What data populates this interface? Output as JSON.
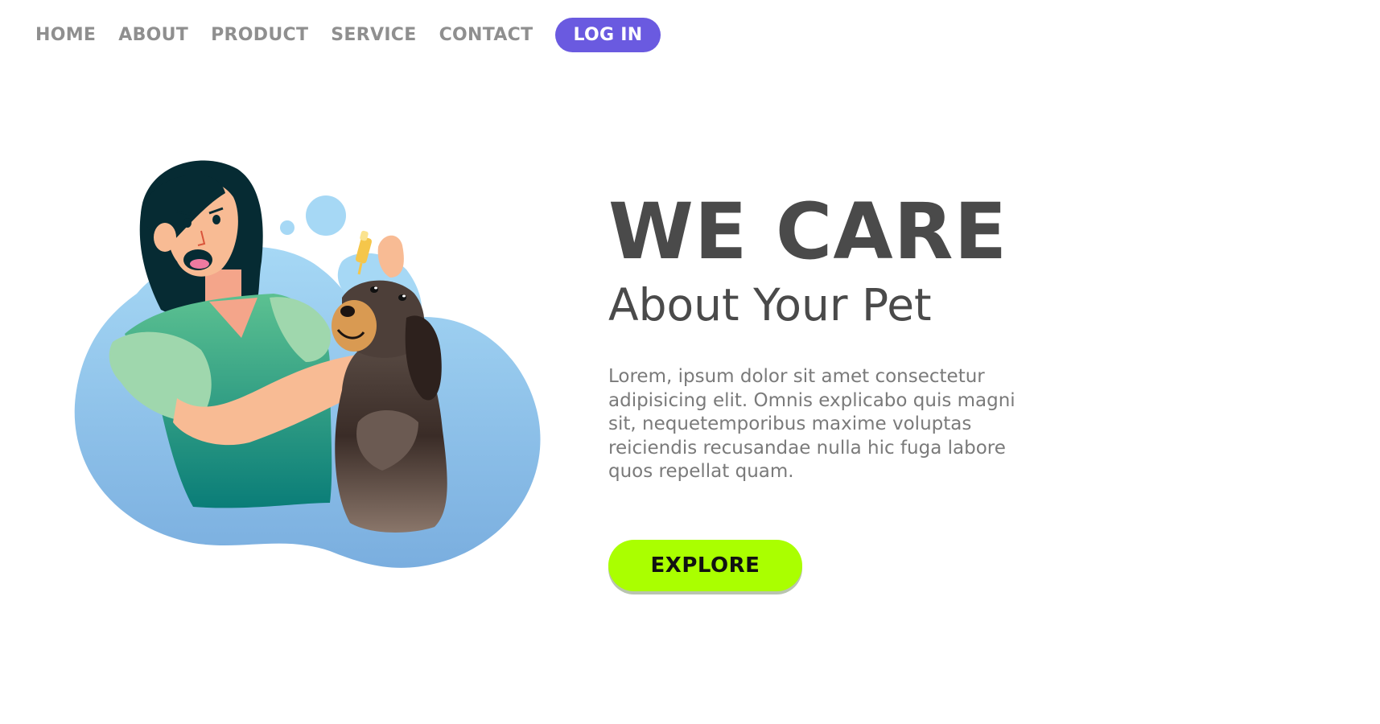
{
  "nav": {
    "items": [
      {
        "label": "HOME"
      },
      {
        "label": "ABOUT"
      },
      {
        "label": "PRODUCT"
      },
      {
        "label": "SERVICE"
      },
      {
        "label": "CONTACT"
      }
    ],
    "login_label": "LOG IN"
  },
  "hero": {
    "title": "WE CARE",
    "subtitle": "About Your Pet",
    "body": "Lorem, ipsum dolor sit amet consectetur adipisicing elit. Omnis explicabo quis magni sit, nequetemporibus maxime voluptas reiciendis recusandae nulla hic fuga labore quos repellat quam.",
    "cta_label": "EXPLORE",
    "illustration": "woman-giving-eye-drops-to-dog-illustration"
  },
  "colors": {
    "accent": "#6a5ae0",
    "cta": "#aaff00",
    "text_dark": "#4a4a4a",
    "text_muted": "#7a7a7a",
    "nav_text": "#8f8f8f",
    "blob_blue": "#8ec7ee",
    "shirt_green": "#3fb08a"
  }
}
